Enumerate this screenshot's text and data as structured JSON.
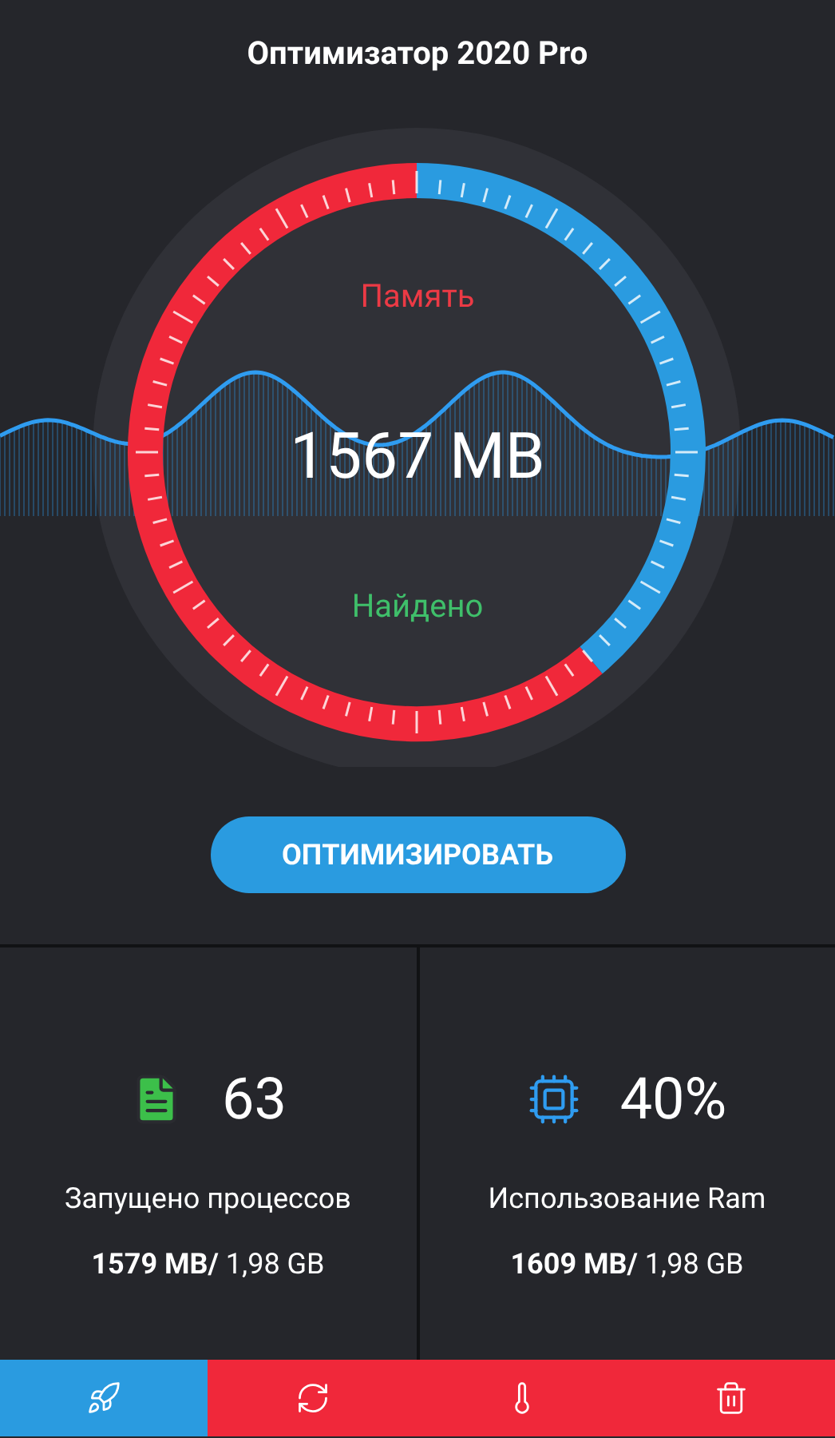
{
  "header": {
    "title": "Оптимизатор 2020 Pro"
  },
  "gauge": {
    "top_label": "Память",
    "value": "1567 MB",
    "bottom_label": "Найдено"
  },
  "optimize_button": {
    "label": "ОПТИМИЗИРОВАТЬ"
  },
  "stats": [
    {
      "value": "63",
      "label": "Запущено процессов",
      "usage": "**1579 MB/** 1,98 GB"
    },
    {
      "value": "40%",
      "label": "Использование Ram",
      "usage": "**1609 MB/** 1,98 GB"
    }
  ],
  "tabs": [
    {
      "selected": true
    },
    {
      "selected": false
    },
    {
      "selected": false
    },
    {
      "selected": false
    }
  ]
}
